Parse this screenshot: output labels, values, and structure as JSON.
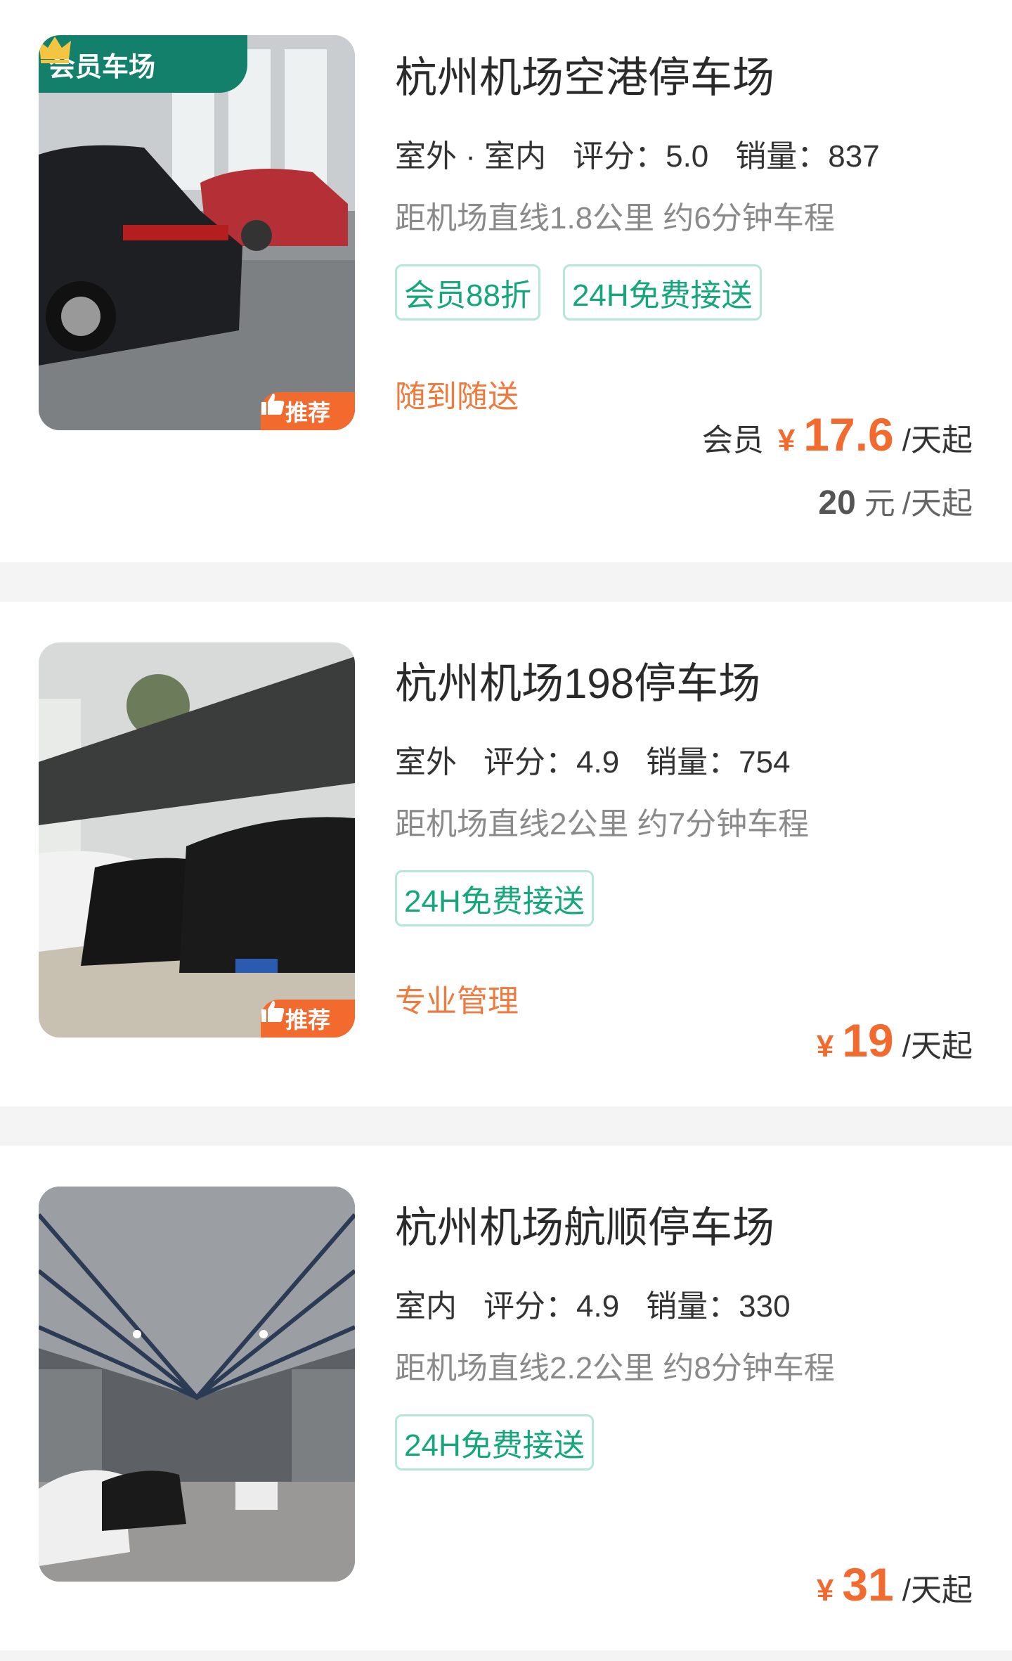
{
  "lots": [
    {
      "title": "杭州机场空港停车场",
      "type": "室外 · 室内",
      "rating_label": "评分：",
      "rating": "5.0",
      "sales_label": "销量：",
      "sales": "837",
      "distance": "距机场直线1.8公里 约6分钟车程",
      "tags": [
        "会员88折",
        "24H免费接送"
      ],
      "feature": "随到随送",
      "member_badge": "会员车场",
      "recommend_badge": "推荐",
      "price_prefix": "会员",
      "currency": "¥",
      "price": "17.6",
      "price_unit": "/天起",
      "original_price": "20",
      "original_unit": "元",
      "original_suffix": "/天起"
    },
    {
      "title": "杭州机场198停车场",
      "type": "室外",
      "rating_label": "评分：",
      "rating": "4.9",
      "sales_label": "销量：",
      "sales": "754",
      "distance": "距机场直线2公里 约7分钟车程",
      "tags": [
        "24H免费接送"
      ],
      "feature": "专业管理",
      "recommend_badge": "推荐",
      "currency": "¥",
      "price": "19",
      "price_unit": "/天起"
    },
    {
      "title": "杭州机场航顺停车场",
      "type": "室内",
      "rating_label": "评分：",
      "rating": "4.9",
      "sales_label": "销量：",
      "sales": "330",
      "distance": "距机场直线2.2公里 约8分钟车程",
      "tags": [
        "24H免费接送"
      ],
      "currency": "¥",
      "price": "31",
      "price_unit": "/天起"
    }
  ],
  "colors": {
    "accent_orange": "#f26a2e",
    "tag_green": "#14a77c",
    "member_green": "#12806a"
  }
}
